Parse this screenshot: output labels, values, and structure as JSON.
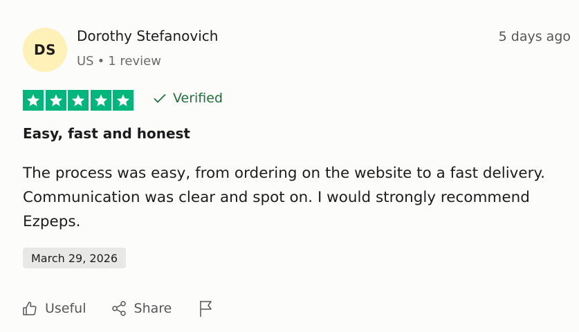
{
  "reviewer": {
    "initials": "DS",
    "name": "Dorothy Stefanovich",
    "country": "US",
    "separator": "•",
    "review_count": "1 review"
  },
  "time_ago": "5 days ago",
  "rating": {
    "value": 5,
    "max": 5,
    "color": "#00b67a"
  },
  "verified_label": "Verified",
  "review": {
    "title": "Easy, fast and honest",
    "body": "The process was easy, from ordering on the website to a fast delivery. Communication was clear and spot on. I would strongly recommend Ezpeps.",
    "date": "March 29, 2026"
  },
  "actions": {
    "useful_label": "Useful",
    "share_label": "Share",
    "flag_icon": "flag-icon"
  },
  "colors": {
    "avatar_bg": "#fff1b8",
    "verified": "#1f6f3a",
    "date_chip_bg": "#e8e8e6"
  }
}
